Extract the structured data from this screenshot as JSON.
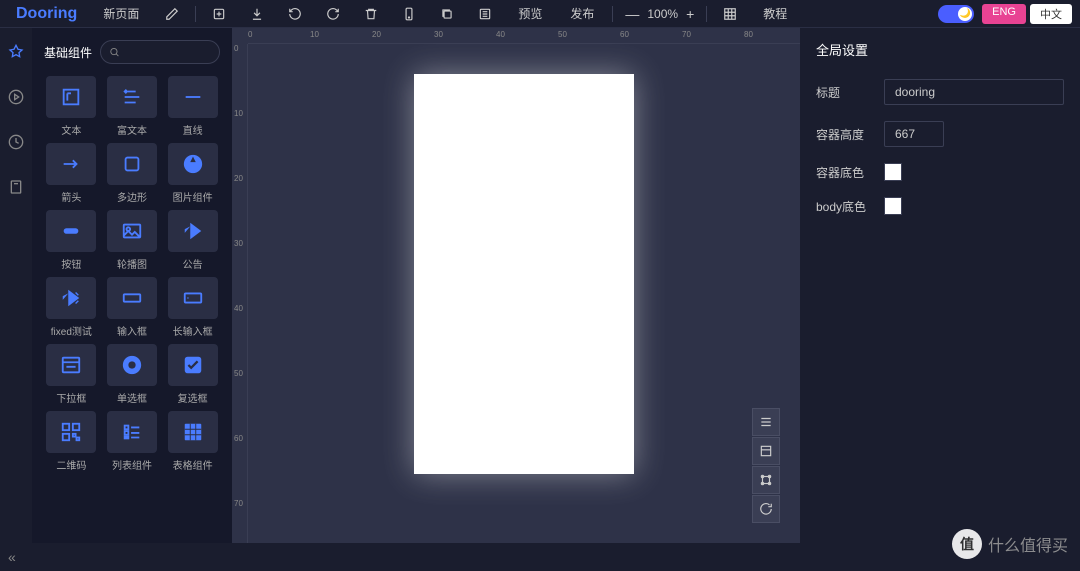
{
  "header": {
    "logo": "Dooring",
    "new_page": "新页面",
    "preview": "预览",
    "publish": "发布",
    "tutorial": "教程",
    "zoom": "100%",
    "lang_eng": "ENG",
    "lang_cn": "中文"
  },
  "component_panel": {
    "title": "基础组件",
    "search_placeholder": "",
    "items": [
      {
        "label": "文本"
      },
      {
        "label": "富文本"
      },
      {
        "label": "直线"
      },
      {
        "label": "箭头"
      },
      {
        "label": "多边形"
      },
      {
        "label": "图片组件"
      },
      {
        "label": "按钮"
      },
      {
        "label": "轮播图"
      },
      {
        "label": "公告"
      },
      {
        "label": "fixed测试"
      },
      {
        "label": "输入框"
      },
      {
        "label": "长输入框"
      },
      {
        "label": "下拉框"
      },
      {
        "label": "单选框"
      },
      {
        "label": "复选框"
      },
      {
        "label": "二维码"
      },
      {
        "label": "列表组件"
      },
      {
        "label": "表格组件"
      }
    ]
  },
  "ruler": {
    "h": [
      "0",
      "10",
      "20",
      "30",
      "40",
      "50",
      "60",
      "70",
      "80"
    ],
    "v": [
      "0",
      "10",
      "20",
      "30",
      "40",
      "50",
      "60",
      "70"
    ]
  },
  "settings": {
    "title": "全局设置",
    "fields": {
      "title_label": "标题",
      "title_value": "dooring",
      "height_label": "容器高度",
      "height_value": "667",
      "bg_label": "容器底色",
      "body_label": "body底色"
    }
  },
  "watermark": "什么值得买"
}
